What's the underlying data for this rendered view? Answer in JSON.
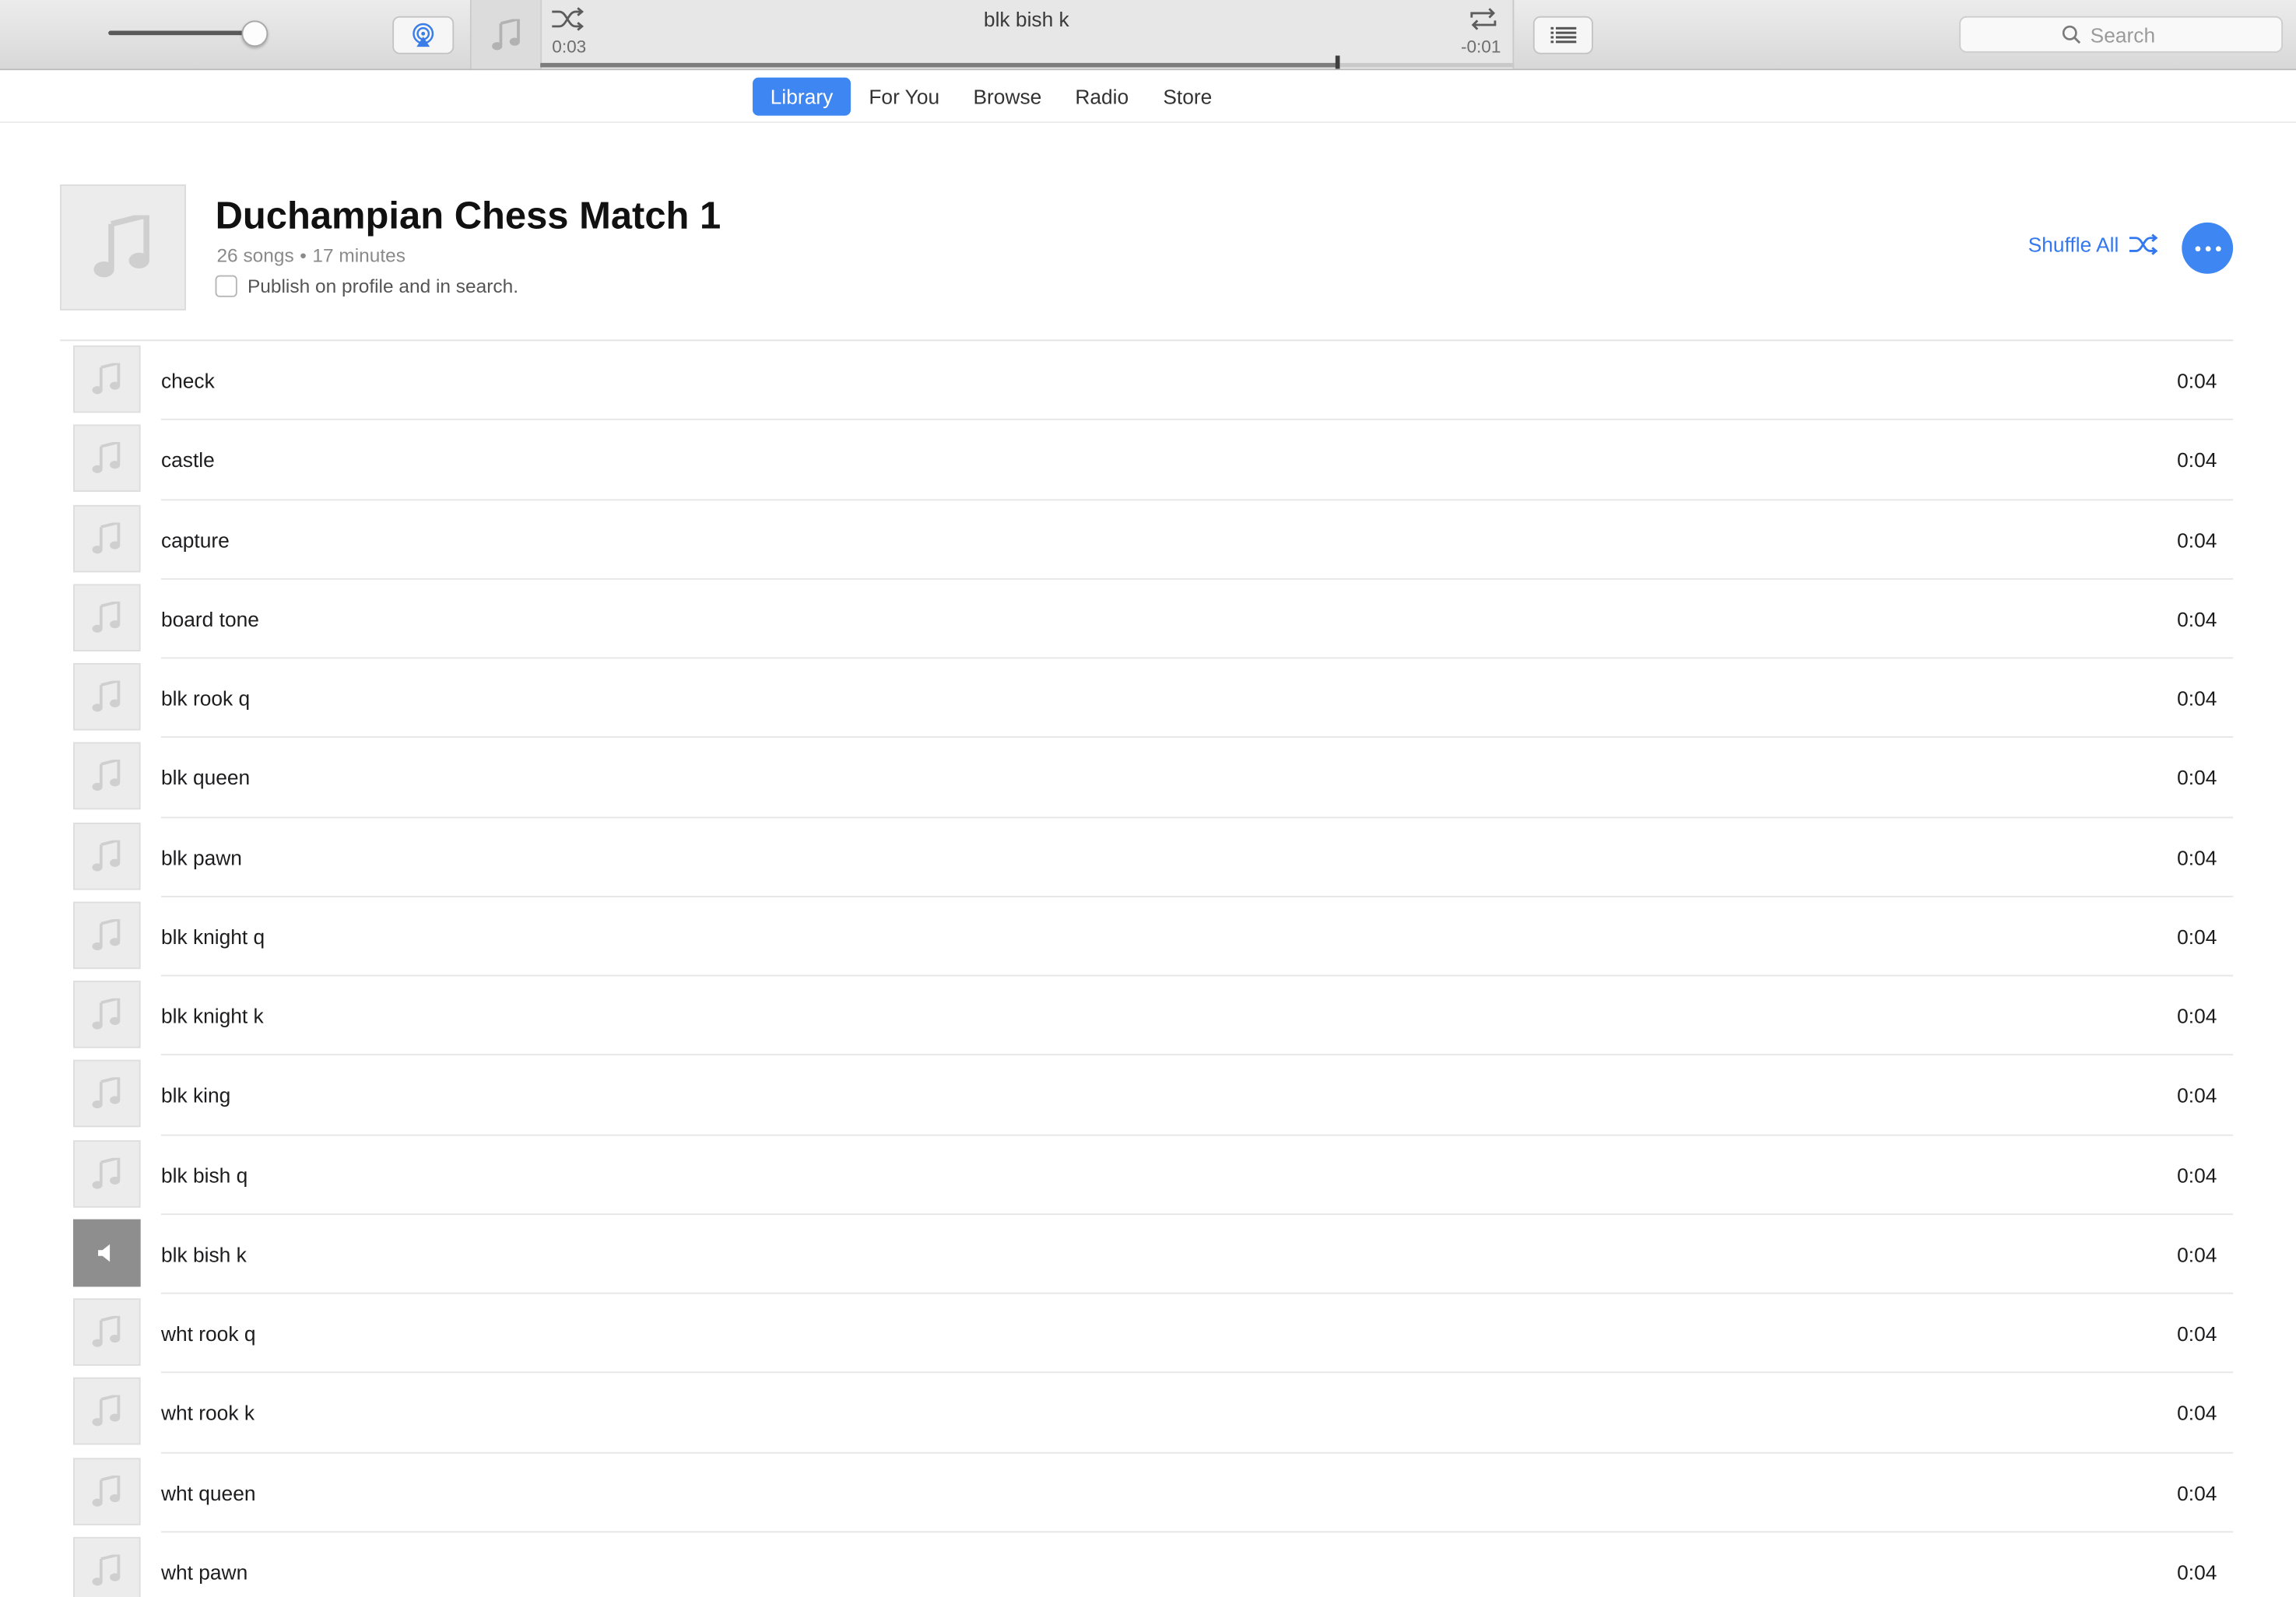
{
  "toolbar": {
    "volume_level": 0.98,
    "now_playing": {
      "title": "blk bish k",
      "elapsed": "0:03",
      "remaining": "-0:01",
      "progress": 0.82
    },
    "search": {
      "placeholder": "Search"
    }
  },
  "nav": {
    "tabs": [
      {
        "label": "Library",
        "active": true
      },
      {
        "label": "For You",
        "active": false
      },
      {
        "label": "Browse",
        "active": false
      },
      {
        "label": "Radio",
        "active": false
      },
      {
        "label": "Store",
        "active": false
      }
    ]
  },
  "playlist": {
    "title": "Duchampian Chess Match 1",
    "song_count": "26 songs",
    "separator": "•",
    "duration": "17 minutes",
    "publish_label": "Publish on profile and in search.",
    "publish_checked": false,
    "shuffle_label": "Shuffle All"
  },
  "accent_color": "#3e86f2",
  "songs": [
    {
      "title": "check",
      "duration": "0:04",
      "playing": false
    },
    {
      "title": "castle",
      "duration": "0:04",
      "playing": false
    },
    {
      "title": "capture",
      "duration": "0:04",
      "playing": false
    },
    {
      "title": "board tone",
      "duration": "0:04",
      "playing": false
    },
    {
      "title": "blk rook q",
      "duration": "0:04",
      "playing": false
    },
    {
      "title": "blk queen",
      "duration": "0:04",
      "playing": false
    },
    {
      "title": "blk pawn",
      "duration": "0:04",
      "playing": false
    },
    {
      "title": "blk knight q",
      "duration": "0:04",
      "playing": false
    },
    {
      "title": "blk knight k",
      "duration": "0:04",
      "playing": false
    },
    {
      "title": "blk king",
      "duration": "0:04",
      "playing": false
    },
    {
      "title": "blk bish q",
      "duration": "0:04",
      "playing": false
    },
    {
      "title": "blk bish k",
      "duration": "0:04",
      "playing": true
    },
    {
      "title": "wht rook q",
      "duration": "0:04",
      "playing": false
    },
    {
      "title": "wht rook k",
      "duration": "0:04",
      "playing": false
    },
    {
      "title": "wht queen",
      "duration": "0:04",
      "playing": false
    },
    {
      "title": "wht pawn",
      "duration": "0:04",
      "playing": false
    }
  ]
}
